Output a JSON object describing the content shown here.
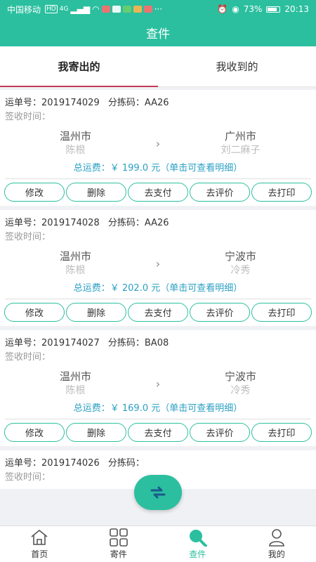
{
  "status_bar": {
    "carrier": "中国移动",
    "hd": "HD",
    "net": "4G",
    "more": "···",
    "battery": "73%",
    "time": "20:13"
  },
  "app_bar": {
    "title": "查件"
  },
  "tabs": [
    {
      "label": "我寄出的",
      "active": true
    },
    {
      "label": "我收到的",
      "active": false
    }
  ],
  "labels": {
    "waybill": "运单号：",
    "sort_code": "分拣码：",
    "sign_time": "签收时间：",
    "fee_prefix": "总运费：",
    "fee_suffix": "（单击可查看明细）"
  },
  "actions": [
    "修改",
    "删除",
    "去支付",
    "去评价",
    "去打印"
  ],
  "shipments": [
    {
      "waybill": "2019174029",
      "sort_code": "AA26",
      "from_city": "温州市",
      "from_name": "陈根",
      "to_city": "广州市",
      "to_name": "刘二麻子",
      "fee": "￥ 199.0 元"
    },
    {
      "waybill": "2019174028",
      "sort_code": "AA26",
      "from_city": "温州市",
      "from_name": "陈根",
      "to_city": "宁波市",
      "to_name": "冷秀",
      "fee": "￥ 202.0 元"
    },
    {
      "waybill": "2019174027",
      "sort_code": "BA08",
      "from_city": "温州市",
      "from_name": "陈根",
      "to_city": "宁波市",
      "to_name": "冷秀",
      "fee": "￥ 169.0 元"
    },
    {
      "waybill": "2019174026",
      "sort_code": "",
      "from_city": "",
      "from_name": "",
      "to_city": "",
      "to_name": "",
      "fee": ""
    }
  ],
  "bottom_nav": [
    {
      "label": "首页",
      "icon": "home-icon",
      "active": false
    },
    {
      "label": "寄件",
      "icon": "grid-icon",
      "active": false
    },
    {
      "label": "查件",
      "icon": "search-icon",
      "active": true
    },
    {
      "label": "我的",
      "icon": "user-icon",
      "active": false
    }
  ],
  "colors": {
    "primary": "#2bbf9f",
    "tab_indicator": "#c23b55",
    "fee_text": "#2b9fc4"
  }
}
